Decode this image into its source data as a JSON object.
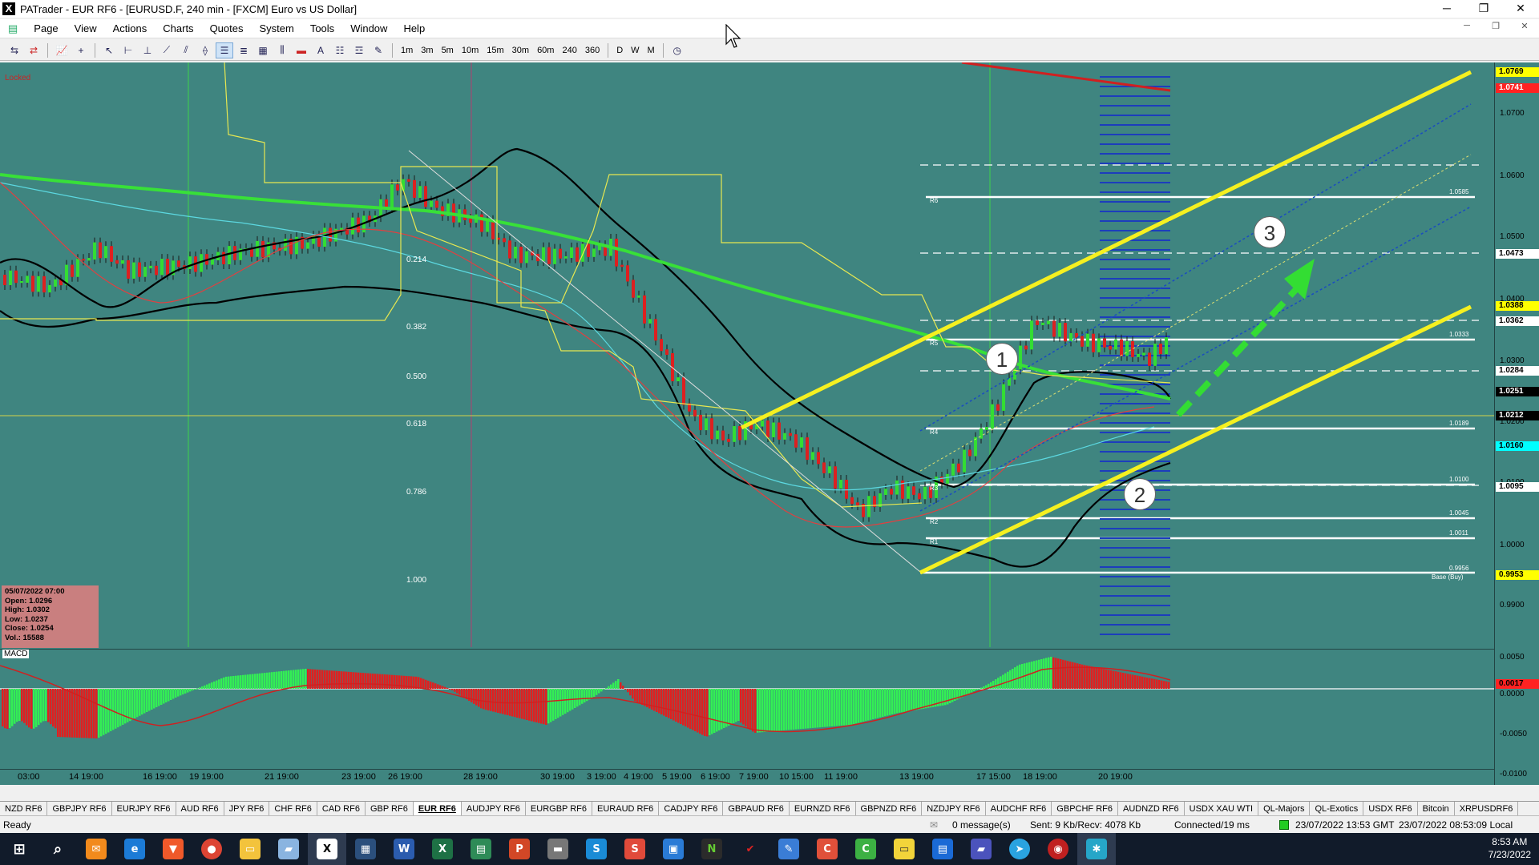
{
  "window": {
    "title": "PATrader - EUR RF6 - [EURUSD.F, 240 min - [FXCM] Euro vs US Dollar]",
    "buttons": [
      "─",
      "❐",
      "✕"
    ]
  },
  "menu": {
    "items": [
      "Page",
      "View",
      "Actions",
      "Charts",
      "Quotes",
      "System",
      "Tools",
      "Window",
      "Help"
    ],
    "mdi_buttons": [
      "─",
      "❐",
      "✕"
    ]
  },
  "toolbar": {
    "timeframes": [
      "1m",
      "3m",
      "5m",
      "10m",
      "15m",
      "30m",
      "60m",
      "240",
      "360",
      "D",
      "W",
      "M"
    ]
  },
  "chart": {
    "locked_label": "Locked",
    "fib_levels": [
      "0.214",
      "0.382",
      "0.500",
      "0.618",
      "0.786",
      "1.000"
    ],
    "pivot_labels": [
      "R6",
      "R5",
      "R4",
      "R3",
      "R2",
      "R1",
      "Base (Buy)"
    ],
    "pivot_values": [
      "1.0585",
      "1.0333",
      "1.0189",
      "1.0100",
      "1.0045",
      "1.0011",
      "0.9956"
    ],
    "callouts": [
      "1",
      "2",
      "3"
    ],
    "macd_label": "MACD",
    "info_box": {
      "date": "05/07/2022 07:00",
      "open": "Open: 1.0296",
      "high": "High: 1.0302",
      "low": "Low: 1.0237",
      "close": "Close: 1.0254",
      "vol": "Vol.: 15588"
    },
    "price_axis": [
      "1.0700",
      "1.0600",
      "1.0500",
      "1.0400",
      "1.0300",
      "1.0200",
      "1.0100",
      "1.0000",
      "0.9900"
    ],
    "price_tags": [
      {
        "value": "1.0769",
        "color": "#ffff00"
      },
      {
        "value": "1.0741",
        "color": "#ff2222"
      },
      {
        "value": "1.0473",
        "color": "#ffffff"
      },
      {
        "value": "1.0388",
        "color": "#ffff00"
      },
      {
        "value": "1.0362",
        "color": "#ffffff"
      },
      {
        "value": "1.0284",
        "color": "#ffffff"
      },
      {
        "value": "1.0251",
        "color": "#000000"
      },
      {
        "value": "1.0212",
        "color": "#000000"
      },
      {
        "value": "1.0160",
        "color": "#00ffff"
      },
      {
        "value": "1.0095",
        "color": "#ffffff"
      },
      {
        "value": "0.9953",
        "color": "#ffff00"
      }
    ],
    "macd_axis": [
      "0.0050",
      "0.0000",
      "-0.0050",
      "-0.0100"
    ],
    "macd_tag": "0.0017",
    "time_labels": [
      "03:00",
      "14 19:00",
      "16 19:00",
      "19 19:00",
      "21 19:00",
      "23 19:00",
      "26 19:00",
      "28 19:00",
      "30 19:00",
      "3 19:00",
      "4 19:00",
      "5 19:00",
      "6 19:00",
      "7 19:00",
      "10 15:00",
      "11 19:00",
      "13 19:00",
      "17 15:00",
      "18 19:00",
      "20 19:00"
    ]
  },
  "tabs": [
    "NZD RF6",
    "GBPJPY RF6",
    "EURJPY RF6",
    "AUD RF6",
    "JPY RF6",
    "CHF RF6",
    "CAD RF6",
    "GBP RF6",
    "EUR RF6",
    "AUDJPY RF6",
    "EURGBP RF6",
    "EURAUD RF6",
    "CADJPY RF6",
    "GBPAUD RF6",
    "EURNZD RF6",
    "GBPNZD RF6",
    "NZDJPY RF6",
    "AUDCHF RF6",
    "GBPCHF RF6",
    "AUDNZD RF6",
    "USDX XAU WTI",
    "QL-Majors",
    "QL-Exotics",
    "USDX RF6",
    "Bitcoin",
    "XRPUSDRF6"
  ],
  "active_tab": "EUR RF6",
  "status": {
    "ready": "Ready",
    "messages": "0 message(s)",
    "sent": "Sent: 9 Kb/Recv: 4078 Kb",
    "connected": "Connected/19 ms",
    "gmt_time": "23/07/2022 13:53 GMT",
    "local_time": "23/07/2022 08:53:09 Local"
  },
  "taskbar": {
    "time": "8:53 AM",
    "date": "7/23/2022"
  }
}
